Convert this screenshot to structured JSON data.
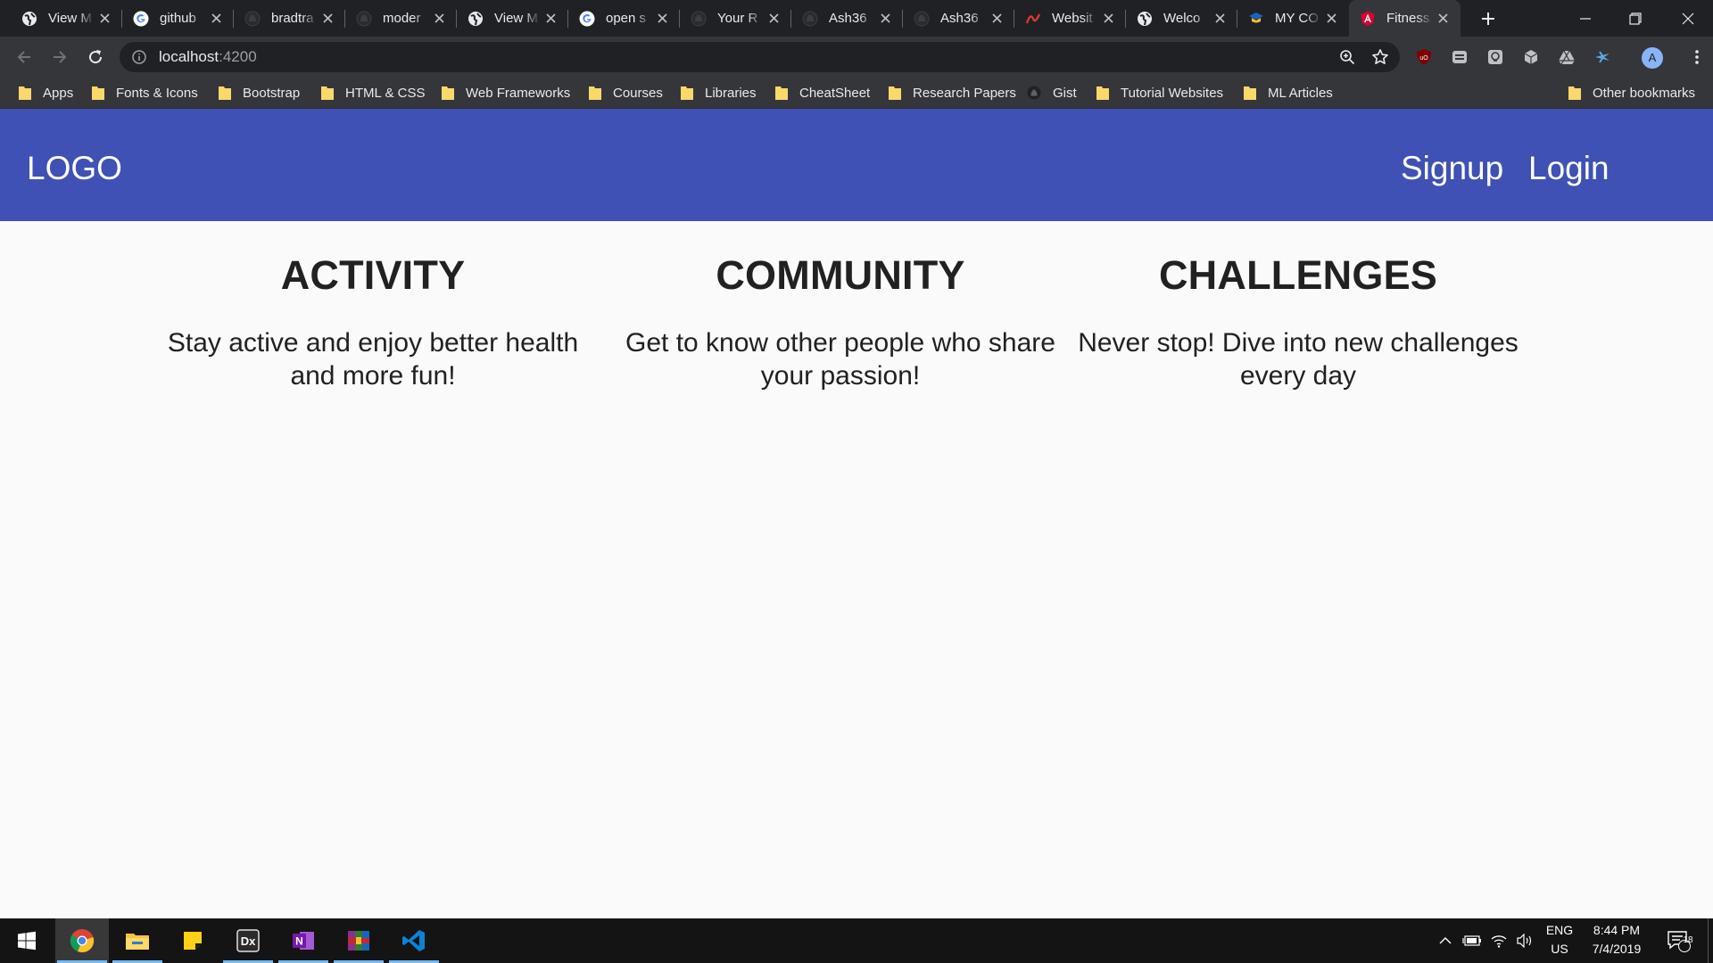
{
  "browser": {
    "tabs": [
      {
        "title": "View M",
        "favicon": "globe-icon"
      },
      {
        "title": "github",
        "favicon": "google-icon"
      },
      {
        "title": "bradtra",
        "favicon": "github-icon"
      },
      {
        "title": "moder",
        "favicon": "github-icon"
      },
      {
        "title": "View M",
        "favicon": "globe-icon"
      },
      {
        "title": "open s",
        "favicon": "google-icon"
      },
      {
        "title": "Your R",
        "favicon": "github-icon"
      },
      {
        "title": "Ash36",
        "favicon": "github-icon"
      },
      {
        "title": "Ash36",
        "favicon": "github-icon"
      },
      {
        "title": "Websit",
        "favicon": "scribble-icon"
      },
      {
        "title": "Welco",
        "favicon": "globe-icon"
      },
      {
        "title": "MY CO",
        "favicon": "graduation-cap-icon"
      },
      {
        "title": "Fitness",
        "favicon": "angular-icon",
        "active": true
      }
    ],
    "url_host": "localhost",
    "url_port": ":4200",
    "bookmarks": [
      {
        "label": "Apps",
        "icon": "folder-icon"
      },
      {
        "label": "Fonts & Icons",
        "icon": "folder-icon"
      },
      {
        "label": "Bootstrap",
        "icon": "folder-icon"
      },
      {
        "label": "HTML & CSS",
        "icon": "folder-icon"
      },
      {
        "label": "Web Frameworks",
        "icon": "folder-icon"
      },
      {
        "label": "Courses",
        "icon": "folder-icon"
      },
      {
        "label": "Libraries",
        "icon": "folder-icon"
      },
      {
        "label": "CheatSheet",
        "icon": "folder-icon"
      },
      {
        "label": "Research Papers",
        "icon": "folder-icon"
      },
      {
        "label": "Gist",
        "icon": "github-icon"
      },
      {
        "label": "Tutorial Websites",
        "icon": "folder-icon"
      },
      {
        "label": "ML Articles",
        "icon": "folder-icon"
      }
    ],
    "other_bookmarks": "Other bookmarks",
    "profile_initial": "A"
  },
  "app": {
    "logo": "LOGO",
    "nav": {
      "signup": "Signup",
      "login": "Login"
    },
    "features": [
      {
        "title": "ACTIVITY",
        "text": "Stay active and enjoy better health and more fun!"
      },
      {
        "title": "COMMUNITY",
        "text": "Get to know other people who share your passion!"
      },
      {
        "title": "CHALLENGES",
        "text": "Never stop! Dive into new challenges every day"
      }
    ]
  },
  "taskbar": {
    "apps": [
      "chrome-icon",
      "file-explorer-icon",
      "sticky-notes-icon",
      "dx-app-icon",
      "onenote-icon",
      "winrar-icon",
      "vscode-icon"
    ],
    "language": "ENG",
    "region": "US",
    "time": "8:44 PM",
    "date": "7/4/2019",
    "notification_count": "18"
  },
  "colors": {
    "app_bar": "#3f51b5",
    "page_background": "#fafafa",
    "browser_frame": "#202124",
    "browser_toolbar": "#35363a",
    "taskbar": "#141414"
  }
}
